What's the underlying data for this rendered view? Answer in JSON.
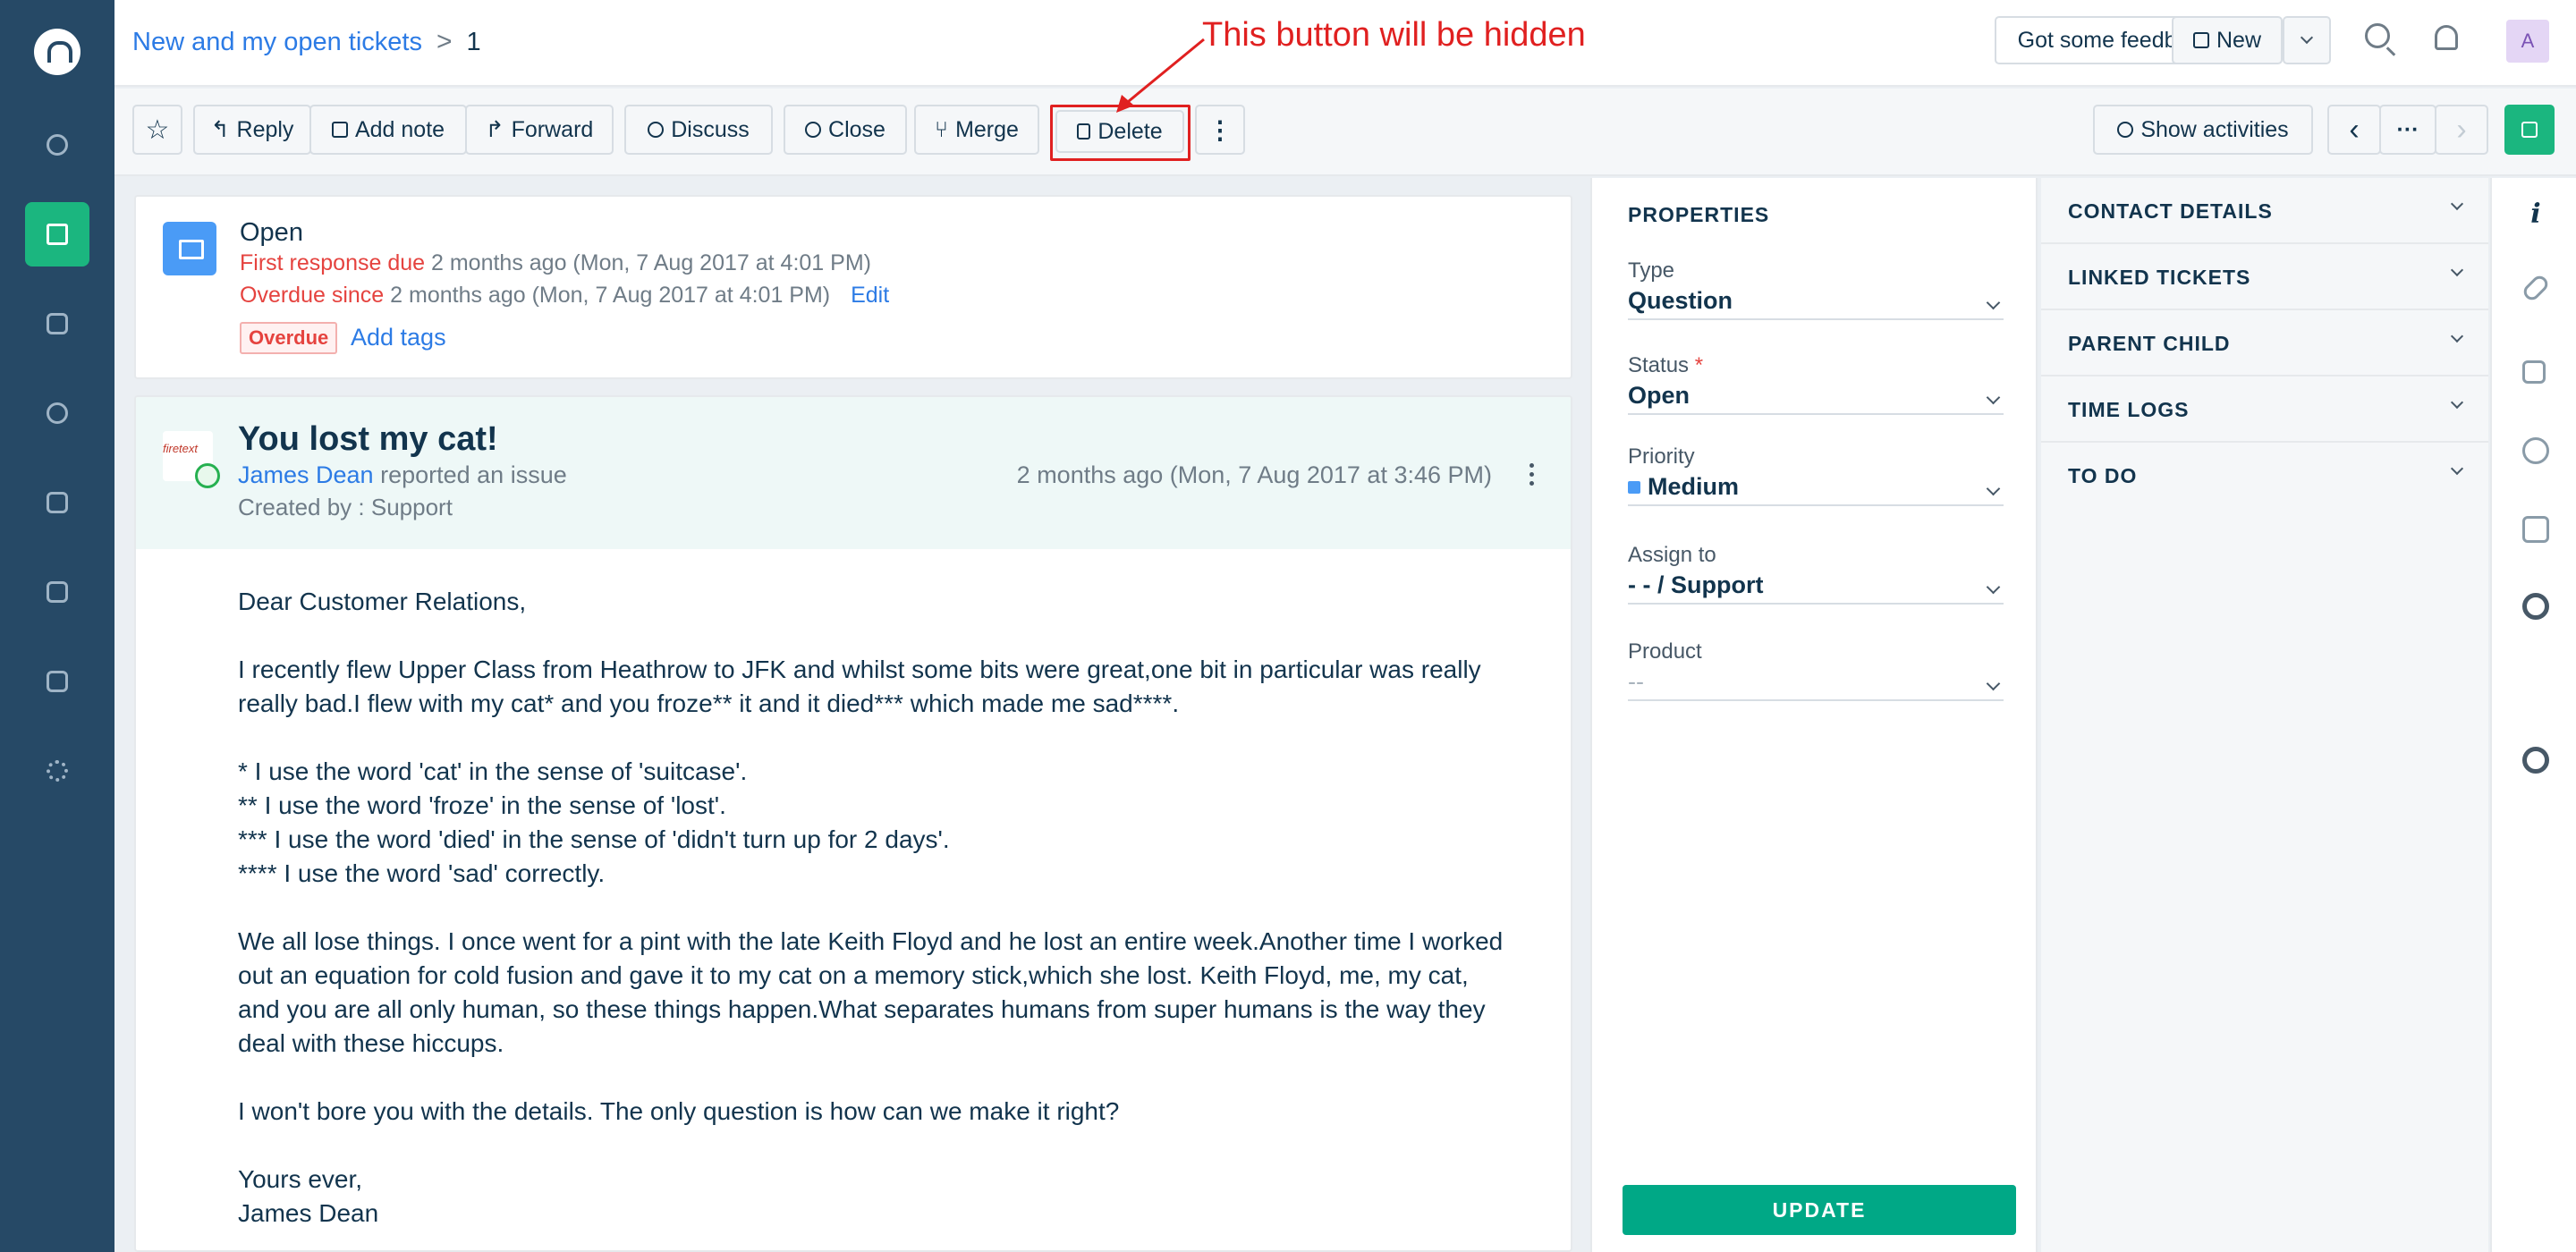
{
  "topbar": {
    "breadcrumb_link": "New and my open tickets",
    "breadcrumb_sep": ">",
    "ticket_id": "1",
    "feedback_label": "Got some feedback?",
    "new_label": "New",
    "avatar_letter": "A"
  },
  "toolbar": {
    "reply": "Reply",
    "add_note": "Add note",
    "forward": "Forward",
    "discuss": "Discuss",
    "close": "Close",
    "merge": "Merge",
    "delete": "Delete",
    "more": "⋮",
    "show_activities": "Show activities",
    "prev": "‹",
    "ellipsis": "···",
    "next": "›"
  },
  "annotation": {
    "text": "This button will be hidden",
    "color": "#e02020"
  },
  "status": {
    "title": "Open",
    "first_response_label": "First response due",
    "first_response_value": "2 months ago (Mon, 7 Aug 2017 at 4:01 PM)",
    "overdue_label": "Overdue since",
    "overdue_value": "2 months ago (Mon, 7 Aug 2017 at 4:01 PM)",
    "edit": "Edit",
    "badge": "Overdue",
    "add_tags": "Add tags"
  },
  "conversation": {
    "subject": "You lost my cat!",
    "requester_name": "James Dean",
    "requester_action": "reported an issue",
    "created_by": "Created by : Support",
    "timestamp": "2 months ago (Mon, 7 Aug 2017 at 3:46 PM)",
    "avatar_text": "firetext",
    "paragraphs": [
      "Dear Customer Relations,",
      "I recently flew Upper Class from Heathrow to JFK and whilst some bits were great,one bit in particular was really really bad.I flew with my cat* and you froze** it and it died*** which made me sad****.",
      "* I use the word 'cat' in the sense of 'suitcase'.\n** I use the word 'froze' in the sense of 'lost'.\n*** I use the word 'died' in the sense of 'didn't turn up for 2 days'.\n**** I use the word 'sad' correctly.",
      "We all lose things. I once went for a pint with the late Keith Floyd and he lost an entire week.Another time I worked out an equation for cold fusion and gave it to my cat on a memory stick,which she lost. Keith Floyd, me, my cat, and you are all only human, so these things happen.What separates humans from super humans is the way they deal with these hiccups.",
      "I won't bore you with the details. The only question is how can we make it right?",
      "Yours ever,\nJames Dean"
    ]
  },
  "properties": {
    "title": "PROPERTIES",
    "type_label": "Type",
    "type_value": "Question",
    "status_label": "Status",
    "status_required": "*",
    "status_value": "Open",
    "priority_label": "Priority",
    "priority_value": "Medium",
    "priority_color": "#4a9bf6",
    "assign_label": "Assign to",
    "assign_value": "- - / Support",
    "product_label": "Product",
    "product_value": "--",
    "update": "UPDATE"
  },
  "accordion": [
    "CONTACT DETAILS",
    "LINKED TICKETS",
    "PARENT CHILD",
    "TIME LOGS",
    "TO DO"
  ],
  "icons": {
    "info": "i"
  },
  "colors": {
    "nav_bg": "#264966",
    "accent_green": "#1bb67f",
    "link_blue": "#2c7be5",
    "overdue_red": "#e5433f",
    "update_green": "#00a886"
  }
}
